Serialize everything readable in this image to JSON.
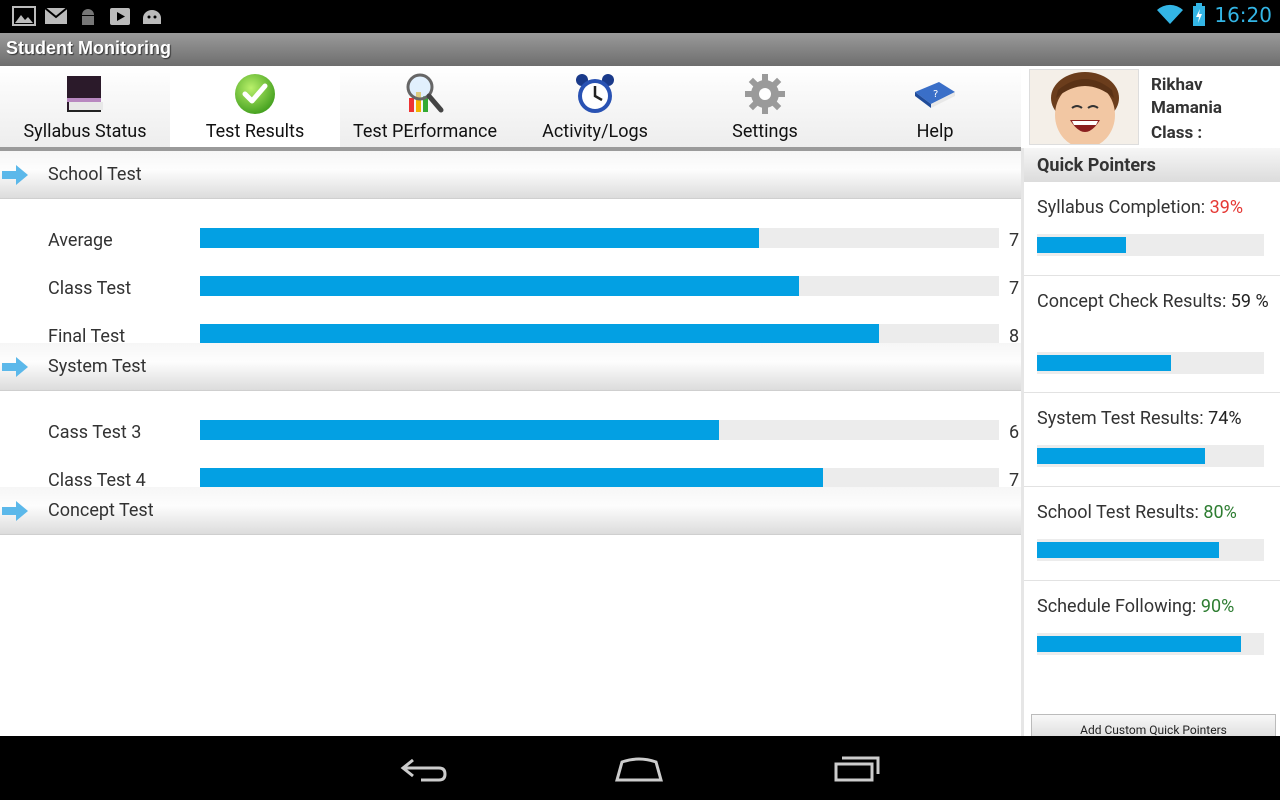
{
  "status_bar": {
    "time": "16:20"
  },
  "app": {
    "title": "Student Monitoring"
  },
  "tabs": [
    {
      "label": "Syllabus Status",
      "icon": "notebook-icon"
    },
    {
      "label": "Test Results",
      "icon": "checkmark-icon",
      "active": true
    },
    {
      "label": "Test PErformance",
      "icon": "magnifier-chart-icon"
    },
    {
      "label": "Activity/Logs",
      "icon": "alarm-clock-icon"
    },
    {
      "label": "Settings",
      "icon": "gear-icon"
    },
    {
      "label": "Help",
      "icon": "help-book-icon"
    }
  ],
  "student": {
    "first_name": "Rikhav",
    "last_name": "Mamania",
    "class_label": "Class :"
  },
  "sections": [
    {
      "title": "School Test",
      "rows": [
        {
          "label": "Average",
          "value": "7",
          "fraction": 0.7
        },
        {
          "label": "Class Test",
          "value": "7",
          "fraction": 0.75
        },
        {
          "label": "Final Test",
          "value": "8",
          "fraction": 0.85
        }
      ]
    },
    {
      "title": "System Test",
      "rows": [
        {
          "label": "Cass Test 3",
          "value": "6",
          "fraction": 0.65
        },
        {
          "label": "Class Test 4",
          "value": "7",
          "fraction": 0.78
        }
      ]
    },
    {
      "title": "Concept Test",
      "rows": []
    }
  ],
  "quick_pointers": {
    "title": "Quick Pointers",
    "items": [
      {
        "label": "Syllabus Completion:",
        "value": "39%",
        "value_color": "#e53935",
        "fraction": 0.39
      },
      {
        "label": "Concept Check Results:",
        "value": "59 %",
        "value_color": "#222222",
        "fraction": 0.59
      },
      {
        "label": "System Test Results:",
        "value": "74%",
        "value_color": "#222222",
        "fraction": 0.74
      },
      {
        "label": "School Test Results:",
        "value": "80%",
        "value_color": "#2e7d32",
        "fraction": 0.8
      },
      {
        "label": "Schedule Following:",
        "value": "90%",
        "value_color": "#2e7d32",
        "fraction": 0.9
      }
    ],
    "add_button": "Add Custom Quick Pointers"
  },
  "colors": {
    "accent": "#03a0e3",
    "status_blue": "#33b5e5"
  }
}
